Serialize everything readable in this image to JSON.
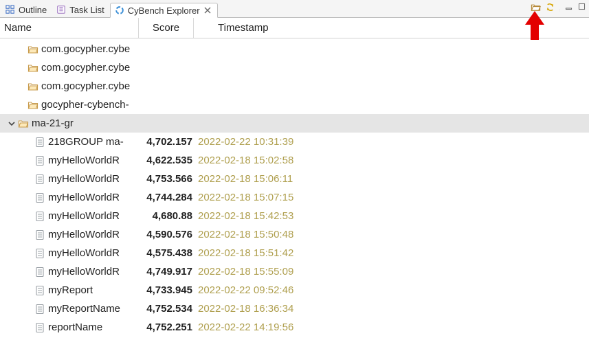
{
  "tabs": [
    {
      "label": "Outline",
      "icon": "outline"
    },
    {
      "label": "Task List",
      "icon": "tasklist"
    },
    {
      "label": "CyBench Explorer",
      "icon": "cybench",
      "active": true,
      "closable": true
    }
  ],
  "columns": {
    "name": "Name",
    "score": "Score",
    "time": "Timestamp"
  },
  "folders": [
    {
      "label": "com.gocypher.cybe",
      "expanded": false
    },
    {
      "label": "com.gocypher.cybe",
      "expanded": false
    },
    {
      "label": "com.gocypher.cybe",
      "expanded": false
    },
    {
      "label": "gocypher-cybench-",
      "expanded": false
    },
    {
      "label": "ma-21-gr",
      "expanded": true,
      "selected": true
    }
  ],
  "reports": [
    {
      "name": "218GROUP ma-",
      "score": "4,702.157",
      "time": "2022-02-22 10:31:39"
    },
    {
      "name": "myHelloWorldR",
      "score": "4,622.535",
      "time": "2022-02-18 15:02:58"
    },
    {
      "name": "myHelloWorldR",
      "score": "4,753.566",
      "time": "2022-02-18 15:06:11"
    },
    {
      "name": "myHelloWorldR",
      "score": "4,744.284",
      "time": "2022-02-18 15:07:15"
    },
    {
      "name": "myHelloWorldR",
      "score": "4,680.88",
      "time": "2022-02-18 15:42:53"
    },
    {
      "name": "myHelloWorldR",
      "score": "4,590.576",
      "time": "2022-02-18 15:50:48"
    },
    {
      "name": "myHelloWorldR",
      "score": "4,575.438",
      "time": "2022-02-18 15:51:42"
    },
    {
      "name": "myHelloWorldR",
      "score": "4,749.917",
      "time": "2022-02-18 15:55:09"
    },
    {
      "name": "myReport",
      "score": "4,733.945",
      "time": "2022-02-22 09:52:46"
    },
    {
      "name": "myReportName",
      "score": "4,752.534",
      "time": "2022-02-18 16:36:34"
    },
    {
      "name": "reportName",
      "score": "4,752.251",
      "time": "2022-02-22 14:19:56"
    }
  ]
}
